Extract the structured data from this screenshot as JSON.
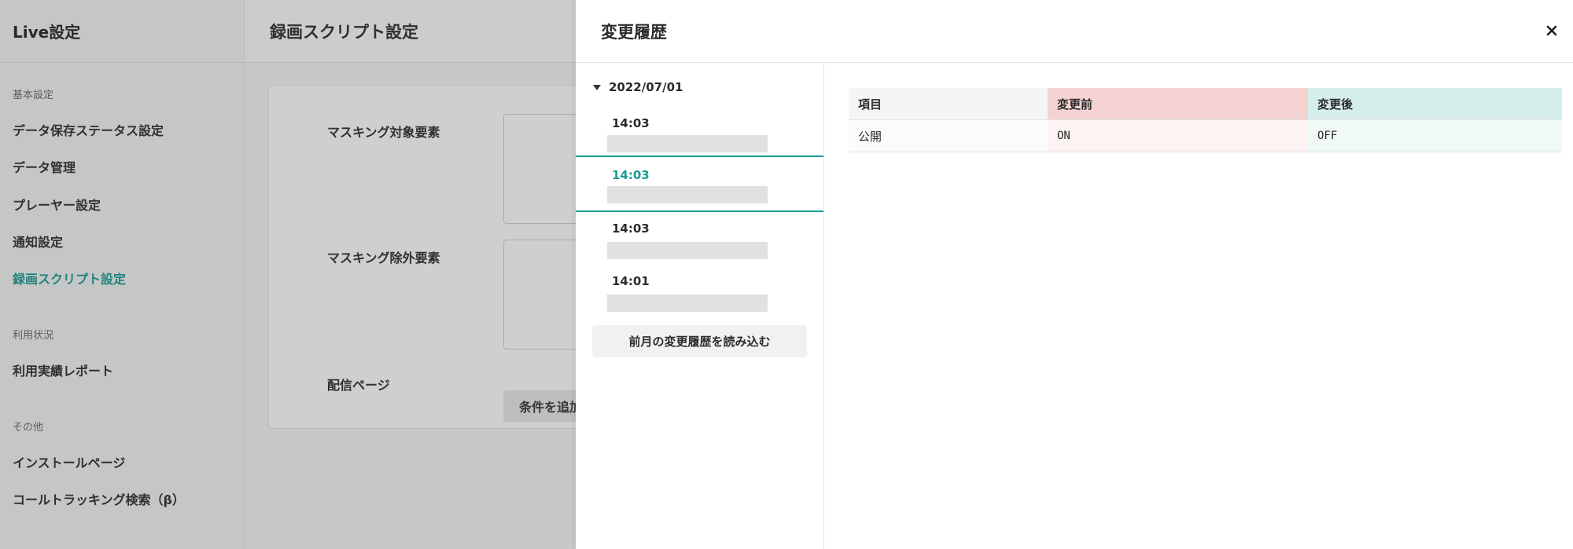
{
  "sidebar": {
    "title": "Live設定",
    "groups": [
      {
        "label": "基本設定",
        "items": [
          "データ保存ステータス設定",
          "データ管理",
          "プレーヤー設定",
          "通知設定",
          "録画スクリプト設定"
        ]
      },
      {
        "label": "利用状況",
        "items": [
          "利用実績レポート"
        ]
      },
      {
        "label": "その他",
        "items": [
          "インストールページ",
          "コールトラッキング検索（β）"
        ]
      }
    ],
    "active_item": "録画スクリプト設定"
  },
  "main": {
    "title": "録画スクリプト設定",
    "fields": {
      "masking_target_label": "マスキング対象要素",
      "masking_exclude_label": "マスキング除外要素",
      "delivery_page_label": "配信ページ",
      "add_condition_label": "条件を追加"
    }
  },
  "drawer": {
    "title": "変更履歴",
    "close_icon": "×",
    "date": "2022/07/01",
    "history": [
      {
        "time": "14:03",
        "selected": false
      },
      {
        "time": "14:03",
        "selected": true
      },
      {
        "time": "14:03",
        "selected": false
      },
      {
        "time": "14:01",
        "selected": false
      }
    ],
    "load_previous_label": "前月の変更履歴を読み込む",
    "table": {
      "headers": [
        "項目",
        "変更前",
        "変更後"
      ],
      "rows": [
        [
          "公開",
          "ON",
          "OFF"
        ]
      ]
    }
  },
  "colors": {
    "accent": "#1a9a93",
    "before_header": "#f5d3d3",
    "after_header": "#d7efec"
  }
}
